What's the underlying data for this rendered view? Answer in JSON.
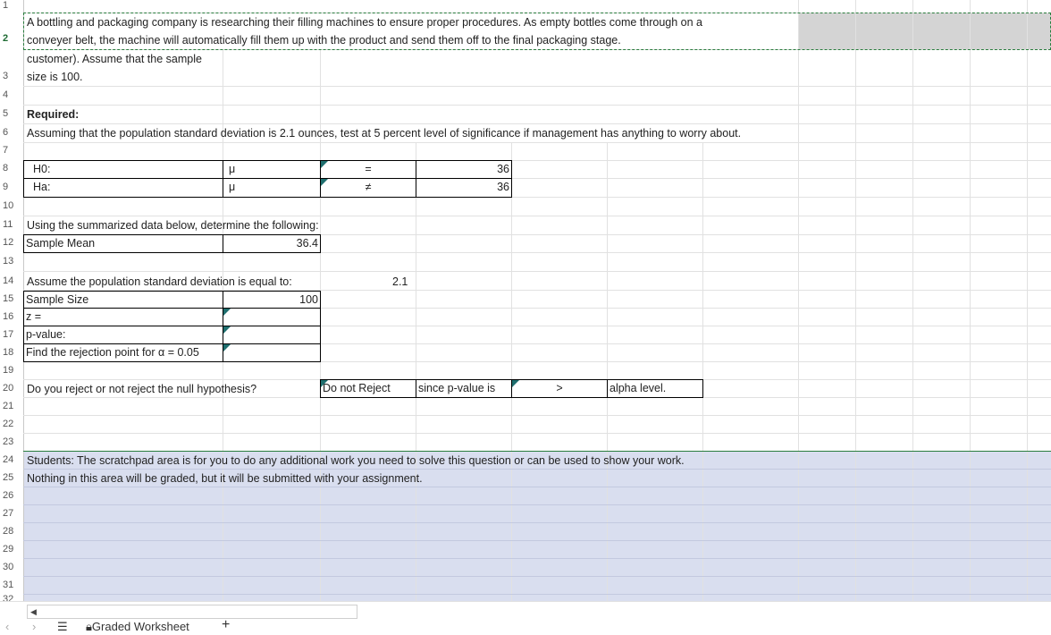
{
  "row_numbers": [
    "1",
    "2",
    "3",
    "4",
    "5",
    "6",
    "7",
    "8",
    "9",
    "10",
    "11",
    "12",
    "13",
    "14",
    "15",
    "16",
    "17",
    "18",
    "19",
    "20",
    "21",
    "22",
    "23",
    "24",
    "25",
    "26",
    "27",
    "28",
    "29",
    "30",
    "31",
    "32"
  ],
  "intro": {
    "line1": "A bottling and packaging company is researching their filling machines to ensure proper procedures. As empty bottles come through on a",
    "line2": "conveyer belt, the machine will automatically fill them up with the product and send them off to the final packaging stage.",
    "line3": "customer). Assume that the sample",
    "line4": "size is 100."
  },
  "required_label": "Required:",
  "question": "Assuming that the population standard deviation is 2.1 ounces, test at 5 percent level of significance if management has anything to worry about.",
  "hypotheses": {
    "h0_label": "H0:",
    "ha_label": "Ha:",
    "mu": "μ",
    "h0_op": "=",
    "ha_op": "≠",
    "h0_value": "36",
    "ha_value": "36"
  },
  "summary_intro": "Using the summarized data below, determine the following:",
  "sample_mean_label": "Sample Mean",
  "sample_mean_value": "36.4",
  "pop_sd_label": "Assume the population standard deviation is equal to:",
  "pop_sd_value": "2.1",
  "sample_size_label": "Sample Size",
  "sample_size_value": "100",
  "z_label": "z =",
  "pvalue_label": "p-value:",
  "rejection_label": "Find the rejection point for α = 0.05",
  "decision": {
    "question": "Do you reject or not reject the null hypothesis?",
    "answer": "Do not Reject",
    "since": "since p-value is",
    "op": ">",
    "alpha": "alpha level."
  },
  "scratch": {
    "line1": "Students: The scratchpad area is for you to do any additional work you need to solve this question or can be used to show your work.",
    "line2": "Nothing in this area will be graded, but it will be submitted with your assignment."
  },
  "sheet_tab": "Graded Worksheet",
  "add_sheet": "+",
  "colors": {
    "scratch_bg": "#d9deef",
    "selection": "#2a7d3e",
    "comment_marker": "#1f6f6f"
  }
}
